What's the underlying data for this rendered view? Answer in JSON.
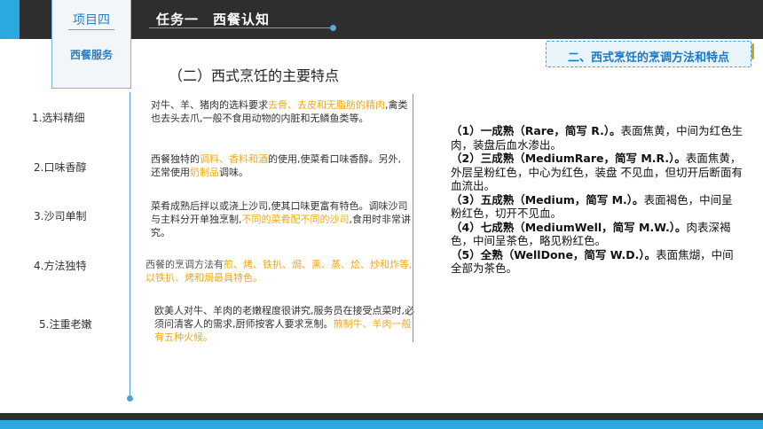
{
  "header": {
    "project_label": "项目四",
    "task_title": "任务一　西餐认知"
  },
  "sidebar": {
    "card_label": "西餐服务"
  },
  "section_tag": "二、西式烹饪的烹调方法和特点",
  "subheading": "（二）西式烹饪的主要特点",
  "items": [
    {
      "label": "1.选料精细",
      "parts": [
        {
          "t": "对牛、羊、猪肉的选料要求",
          "hl": false
        },
        {
          "t": "去骨、去皮和无脂肪的精肉",
          "hl": true
        },
        {
          "t": ",禽类也去头去爪,一般不食用动物的内脏和无鳞鱼类等。",
          "hl": false
        }
      ]
    },
    {
      "label": "2.口味香醇",
      "parts": [
        {
          "t": "西餐独特的",
          "hl": false
        },
        {
          "t": "调料、香料和酒",
          "hl": true
        },
        {
          "t": "的使用,使菜肴口味香醇。另外,还常使用",
          "hl": false
        },
        {
          "t": "奶制品",
          "hl": true
        },
        {
          "t": "调味。",
          "hl": false
        }
      ]
    },
    {
      "label": "3.沙司单制",
      "parts": [
        {
          "t": "菜肴成熟后拌以或浇上沙司,使其口味更富有特色。调味沙司与主料分开单独烹制,",
          "hl": false
        },
        {
          "t": "不同的菜肴配不同的沙司",
          "hl": true
        },
        {
          "t": ",食用时非常讲究。",
          "hl": false
        }
      ]
    },
    {
      "label": "4.方法独特",
      "parts": [
        {
          "t": "西餐的烹调方法有",
          "hl": false
        },
        {
          "t": "煎、烤、铁扒、焗、熏、蒸、烩、炒和炸等,以铁扒、烤和焗最具特色。",
          "hl": true
        }
      ]
    },
    {
      "label": "5.注重老嫩",
      "parts": [
        {
          "t": "欧美人对牛、羊肉的老嫩程度很讲究,服务员在接受点菜时,必须问清客人的需求,厨师按客人要求烹制。",
          "hl": false
        },
        {
          "t": "煎制牛、羊肉一般有五种火候。",
          "hl": true
        }
      ]
    }
  ],
  "doneness": [
    {
      "head": "（1）一成熟（Rare，简写 R.）。",
      "body": "表面焦黄，中间为红色生肉，装盘后血水渗出。"
    },
    {
      "head": "（2）三成熟（MediumRare，简写 M.R.）。",
      "body": "表面焦黄，外层呈粉红色，中心为红色，装盘 不见血，但切开后断面有血流出。"
    },
    {
      "head": "（3）五成熟（Medium，简写 M.）。",
      "body": "表面褐色，中间呈粉红色，切开不见血。"
    },
    {
      "head": "（4）七成熟（MediumWell，简写 M.W.）。",
      "body": "肉表深褐色，中间呈茶色，略见粉红色。"
    },
    {
      "head": "（5）全熟（WellDone，简写 W.D.）。",
      "body": "表面焦煳，中间全部为茶色。"
    }
  ],
  "colors": {
    "accent": "#2aa9e0",
    "highlight": "#f0a81c",
    "bar": "#2e2e2e"
  },
  "icons": {
    "logo": "layers-logo-icon"
  }
}
